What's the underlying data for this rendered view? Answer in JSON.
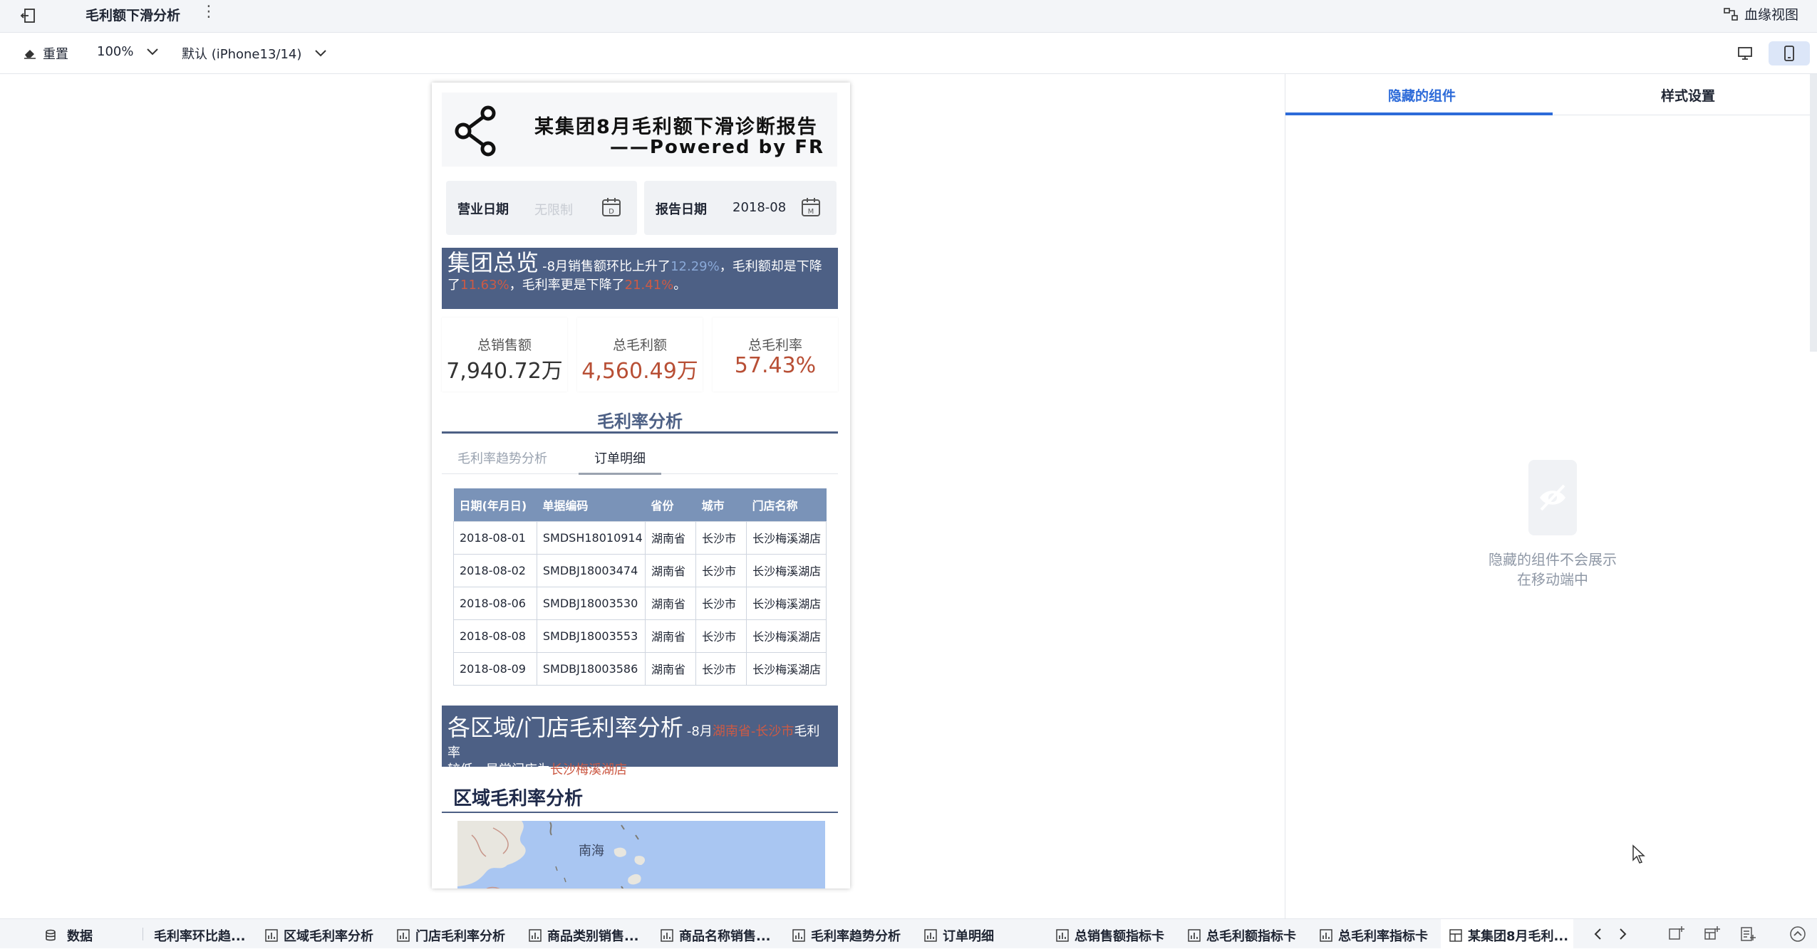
{
  "topbar": {
    "title": "毛利额下滑分析",
    "more": "⋮",
    "lineage": "血缘视图"
  },
  "toolbar": {
    "reset": "重置",
    "zoom": "100%",
    "device": "默认 (iPhone13/14)"
  },
  "report": {
    "header_line1": "某集团8月毛利额下滑诊断报告",
    "header_line2": "——Powered by FR",
    "business_date_label": "营业日期",
    "business_date_placeholder": "无限制",
    "report_date_label": "报告日期",
    "report_date_value": "2018-08",
    "overview": {
      "title": "集团总览",
      "text_a": "-8月销售额环比上升了",
      "sales_growth": "12.29%",
      "text_b": "，毛利额却是下降了",
      "profit_drop": "11.63%",
      "text_c": "，毛利率更是下降了",
      "rate_drop": "21.41%",
      "text_d": "。"
    },
    "kpis": [
      {
        "label": "总销售额",
        "value": "7,940.72万"
      },
      {
        "label": "总毛利额",
        "value": "4,560.49万"
      },
      {
        "label": "总毛利率",
        "value": "57.43%"
      }
    ],
    "rate_section_title": "毛利率分析",
    "tabs": [
      "毛利率趋势分析",
      "订单明细"
    ],
    "table": {
      "headers": [
        "日期(年月日)",
        "单据编码",
        "省份",
        "城市",
        "门店名称"
      ],
      "rows": [
        [
          "2018-08-01",
          "SMDSH18010914",
          "湖南省",
          "长沙市",
          "长沙梅溪湖店"
        ],
        [
          "2018-08-02",
          "SMDBJ18003474",
          "湖南省",
          "长沙市",
          "长沙梅溪湖店"
        ],
        [
          "2018-08-06",
          "SMDBJ18003530",
          "湖南省",
          "长沙市",
          "长沙梅溪湖店"
        ],
        [
          "2018-08-08",
          "SMDBJ18003553",
          "湖南省",
          "长沙市",
          "长沙梅溪湖店"
        ],
        [
          "2018-08-09",
          "SMDBJ18003586",
          "湖南省",
          "长沙市",
          "长沙梅溪湖店"
        ]
      ]
    },
    "region_banner": {
      "title": "各区域/门店毛利率分析",
      "text_a": "-8月",
      "region": "湖南省-长沙市",
      "text_b": "毛利率",
      "text_c": "较低，异常门店为",
      "store": "长沙梅溪湖店"
    },
    "region_title": "区域毛利率分析",
    "map_label": "南海"
  },
  "right_panel": {
    "tab_hidden": "隐藏的组件",
    "tab_style": "样式设置",
    "empty_line1": "隐藏的组件不会展示",
    "empty_line2": "在移动端中"
  },
  "bottom_tabs": [
    {
      "label": "数据",
      "icon": "database-icon"
    },
    {
      "label": "毛利率环比趋...",
      "icon": "chart-icon"
    },
    {
      "label": "区域毛利率分析",
      "icon": "chart-icon"
    },
    {
      "label": "门店毛利率分析",
      "icon": "chart-icon"
    },
    {
      "label": "商品类别销售...",
      "icon": "chart-icon"
    },
    {
      "label": "商品名称销售...",
      "icon": "chart-icon"
    },
    {
      "label": "毛利率趋势分析",
      "icon": "chart-icon"
    },
    {
      "label": "订单明细",
      "icon": "chart-icon"
    },
    {
      "label": "总销售额指标卡",
      "icon": "chart-icon"
    },
    {
      "label": "总毛利额指标卡",
      "icon": "chart-icon"
    },
    {
      "label": "总毛利率指标卡",
      "icon": "chart-icon"
    },
    {
      "label": "某集团8月毛利...",
      "icon": "dashboard-icon"
    }
  ],
  "colors": {
    "accent": "#2d6bd9",
    "banner": "#4d6085",
    "table_header": "#7a93b8",
    "highlight_red": "#cc5a45",
    "highlight_blue": "#8aa9d8"
  }
}
